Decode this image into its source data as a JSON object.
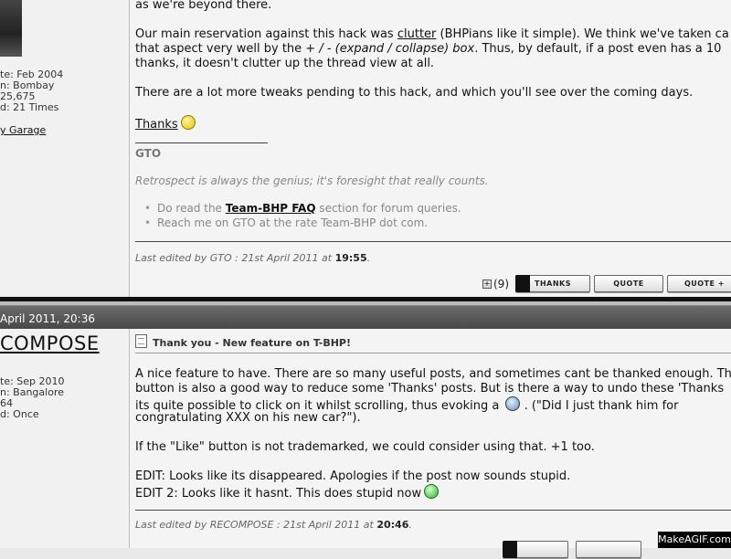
{
  "post1": {
    "user": {
      "join_date": "te: Feb 2004",
      "location": "n: Bombay",
      "posts": "25,675",
      "thanked": "d: 21 Times",
      "garage_link": "y Garage"
    },
    "body": {
      "line0": "as we're beyond there.",
      "p1_l1_a": "Our main reservation against this hack was ",
      "p1_l1_link": "clutter",
      "p1_l1_b": " (BHPians like it simple). We think we've taken ca",
      "p1_l2_a": "that aspect very well by the ",
      "p1_l2_i": "+ / - (expand / collapse) box",
      "p1_l2_b": ". Thus, by default, if a post even has a 10",
      "p1_l3": "thanks, it doesn't clutter up the thread view at all.",
      "p2": "There are a lot more tweaks pending to this hack, and which you'll see over the coming days.",
      "thanks": "Thanks"
    },
    "signature": {
      "name": "GTO",
      "quote": "Retrospect is always the genius; it's foresight that really counts.",
      "bullet1_a": "Do read the ",
      "bullet1_link": "Team-BHP FAQ",
      "bullet1_b": " section for forum queries.",
      "bullet2": "Reach me on GTO at the rate Team-BHP dot com."
    },
    "edited": {
      "prefix": "Last edited by GTO : 21st April 2011 at ",
      "time": "19:55",
      "suffix": "."
    },
    "toolbar": {
      "thanks_count": "(9)",
      "thanks_label": "THANKS",
      "quote_label": "QUOTE",
      "quote_plus_label": "QUOTE +"
    }
  },
  "post2": {
    "date": "April 2011, 20:36",
    "user": {
      "username": "COMPOSE",
      "join_date": "te: Sep 2010",
      "location": "n: Bangalore",
      "posts": "64",
      "thanked": "d: Once"
    },
    "title": "Thank you - New feature on T-BHP!",
    "body": {
      "l1": "A nice feature to have. There are so many useful posts, and sometimes cant be thanked enough. Th",
      "l2": "button is also a good way to reduce some 'Thanks' posts. But is there a way to undo these 'Thanks",
      "l3_a": "its quite possible to click on it whilst scrolling, thus evoking a ",
      "l3_b": " . (\"Did I just thank him for",
      "l4": "congratulating XXX on his new car?\").",
      "l5": "If the \"Like\" button is not trademarked, we could consider using that. +1 too.",
      "l6": "EDIT: Looks like its disappeared. Apologies if the post now sounds stupid.",
      "l7": "EDIT 2: Looks like it hasnt. This does stupid now"
    },
    "edited": {
      "prefix": "Last edited by RECOMPOSE : 21st April 2011 at ",
      "time": "20:46",
      "suffix": "."
    }
  },
  "watermark": "MakeAGIF.com"
}
